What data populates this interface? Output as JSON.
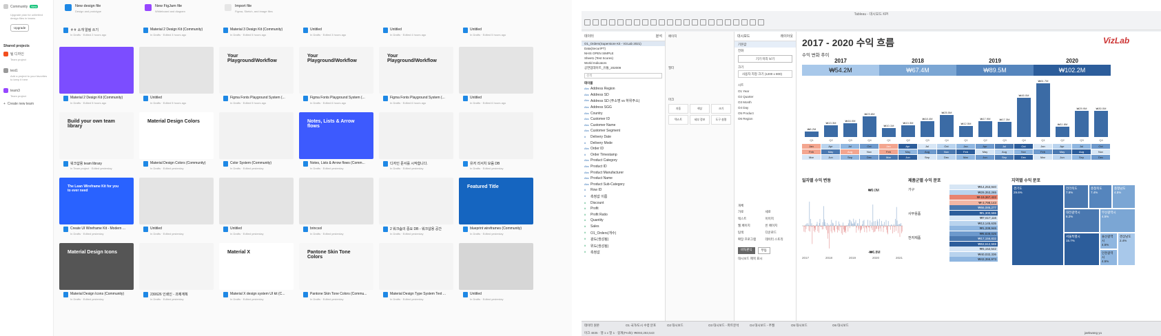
{
  "figma": {
    "sidebar": {
      "community": "Community",
      "new_badge": "New",
      "upgrade_text": "Upgrade plan for unlimited design files in teams",
      "upgrade_btn": "Upgrade",
      "shared": "Shared projects",
      "team1": "팀 디자인",
      "team1_sub": "Team project",
      "team2": "test1",
      "team2_sub": "Add a project to your favorites to keep it here",
      "team3": "team3",
      "team3_sub": "Team project",
      "create": "Create new team"
    },
    "newrow": [
      {
        "t1": "New design file",
        "t2": "Design and prototype",
        "color": "#1e88e5"
      },
      {
        "t1": "New FigJam file",
        "t2": "Whiteboard and diagram",
        "color": "#9747ff"
      },
      {
        "t1": "Import file",
        "t2": "Figma, Sketch, and image files",
        "color": "#e6e6e6"
      }
    ],
    "row0": [
      {
        "title": "ㅎㅎ 소개 알림 쓰기",
        "sub": "In Drafts · Edited 2 hours ago"
      },
      {
        "title": "Material 2 Design Kit (Community)",
        "sub": "In Drafts · Edited 3 hours ago"
      },
      {
        "title": "Material 3 Design Kit (Community)",
        "sub": "In Drafts · Edited 5 hours ago"
      },
      {
        "title": "Untitled",
        "sub": "In Drafts · Edited 3 hours ago"
      },
      {
        "title": "Untitled",
        "sub": "In Drafts · Edited 4 hours ago"
      },
      {
        "title": "Untitled",
        "sub": "In Drafts · Edited 5 hours ago"
      }
    ],
    "cards": [
      [
        {
          "title": "Material 2 Design Kit (Community)",
          "sub": "In Drafts · Edited 5 hours ago",
          "ttl": ""
        },
        {
          "title": "Untitled",
          "sub": "In Drafts · Edited 5 hours ago",
          "ttl": ""
        },
        {
          "title": "Figma Fonts Playground System (...",
          "sub": "In Drafts · Edited 5 hours ago",
          "ttl": "Your Playground/Workflow"
        },
        {
          "title": "Figma Fonts Playground System (...",
          "sub": "In Drafts · Edited 6 hours ago",
          "ttl": "Your Playground/Workflow"
        },
        {
          "title": "Figma Fonts Playground System (...",
          "sub": "In Drafts · Edited 6 hours ago",
          "ttl": "Your Playground/Workflow"
        },
        {
          "title": "Untitled",
          "sub": "In Drafts · Edited 6 hours ago",
          "ttl": ""
        }
      ],
      [
        {
          "title": "워크샵용 team library",
          "sub": "In Team project · Edited yesterday",
          "ttl": "Build your own team library"
        },
        {
          "title": "Material Design Colors (Community)",
          "sub": "In Drafts · Edited yesterday",
          "ttl": "Material Design Colors"
        },
        {
          "title": "Color System (Community)",
          "sub": "In Drafts · Edited yesterday",
          "ttl": ""
        },
        {
          "title": "Notes, Lists & Arrow flows (Comm...",
          "sub": "In Drafts · Edited yesterday",
          "ttl": "Notes, Lists & Arrow flows"
        },
        {
          "title": "디자인 문서를 시작합니다.",
          "sub": "In Drafts · Edited yesterday",
          "ttl": ""
        },
        {
          "title": "유저 리서치 모음 DB",
          "sub": "In Drafts · Edited yesterday",
          "ttl": ""
        }
      ],
      [
        {
          "title": "Create UI Wireframe Kit - Modern ...",
          "sub": "In Drafts · Edited yesterday",
          "ttl": "The Lean Wireframe Kit for you to ever need"
        },
        {
          "title": "Untitled",
          "sub": "In Drafts · Edited yesterday",
          "ttl": ""
        },
        {
          "title": "Untitled",
          "sub": "In Drafts · Edited yesterday",
          "ttl": ""
        },
        {
          "title": "brincsol",
          "sub": "In Drafts · Edited yesterday",
          "ttl": ""
        },
        {
          "title": "2 워크숍의 중요 DB - 워크샵용 공간",
          "sub": "In Drafts · Edited yesterday",
          "ttl": ""
        },
        {
          "title": "blueprint wireframes (Community)",
          "sub": "In Drafts · Edited yesterday",
          "ttl": "Featured Title"
        }
      ],
      [
        {
          "title": "Material Design Icons (Community)",
          "sub": "In Drafts · Edited yesterday",
          "ttl": "Material Design Icons"
        },
        {
          "title": "230626 인쇄인 - 과제계획",
          "sub": "In Drafts · Edited yesterday",
          "ttl": ""
        },
        {
          "title": "Material X design system UI kit (C...",
          "sub": "In Drafts · Edited yesterday",
          "ttl": "Material X"
        },
        {
          "title": "Pantone Skin Tone Colors (Commu...",
          "sub": "In Drafts · Edited yesterday",
          "ttl": "Pantone Skin Tone Colors"
        },
        {
          "title": "Material Design Type System Text ...",
          "sub": "In Drafts · Edited yesterday",
          "ttl": ""
        },
        {
          "title": "Untitled",
          "sub": "In Drafts · Edited yesterday",
          "ttl": ""
        }
      ]
    ]
  },
  "tableau": {
    "window_title": "Tableau - 대시보드 KPI",
    "data_tab": "데이터",
    "analytics_tab": "분석",
    "datasources": [
      "O1_Orders(Superstore Kit - VizLab 2021)",
      "Data(SecuriPT)",
      "NHIS OPEN SIMPLE",
      "Sheet1 (Test Scores)",
      "World Indicators",
      "공연업데이트_유통_202009"
    ],
    "search": "검색",
    "table_hdr": "테이블",
    "fields": [
      [
        "Abc",
        "Address Region"
      ],
      [
        "Abc",
        "Address SD"
      ],
      [
        "Abc",
        "Address SD (주소명 vs 하위주소)"
      ],
      [
        "Abc",
        "Address SGG"
      ],
      [
        "Abc",
        "Country"
      ],
      [
        "Abc",
        "Customer ID"
      ],
      [
        "Abc",
        "Customer Name"
      ],
      [
        "Abc",
        "Customer Segment"
      ],
      [
        "#",
        "Delivery Date"
      ],
      [
        "#",
        "Delivery Mode"
      ],
      [
        "Abc",
        "Order ID"
      ],
      [
        "#",
        "Order Timestamp"
      ],
      [
        "Abc",
        "Product Category"
      ],
      [
        "Abc",
        "Product ID"
      ],
      [
        "Abc",
        "Product Manufacturer"
      ],
      [
        "Abc",
        "Product Name"
      ],
      [
        "Abc",
        "Product Sub-Category"
      ],
      [
        "#",
        "Row ID"
      ],
      [
        "#",
        "측정값 이름"
      ],
      [
        "m",
        "Discount"
      ],
      [
        "m",
        "Profit"
      ],
      [
        "m",
        "Profit Ratio"
      ],
      [
        "m",
        "Quantity"
      ],
      [
        "m",
        "Sales"
      ],
      [
        "m",
        "O1_Orders(개수)"
      ],
      [
        "m",
        "광도(생성됨)"
      ],
      [
        "m",
        "위도(생성됨)"
      ],
      [
        "m",
        "측정값"
      ]
    ],
    "pages": "페이지",
    "filters": "필터",
    "marks": "마크",
    "mark_items": [
      "자동",
      "색상",
      "크기",
      "텍스트",
      "세부 정보",
      "도구 설명"
    ],
    "dash_tab": "대시보드",
    "layout_tab": "레이아웃",
    "device": "기본값",
    "device2": "전화",
    "preview": "기기 미리 보기",
    "size_label": "크기",
    "size_value": "사용자 지정 크기 (1200 x 800)",
    "sheets_label": "시트",
    "sheets": [
      "O1 Year",
      "O2 Quarter",
      "O3 Month",
      "O4 Day",
      "O5 Product",
      "O6 Region"
    ],
    "objects_label": "개체",
    "objects": [
      "가로",
      "세로",
      "텍스트",
      "이미지",
      "웹 페이지",
      "빈 페이지",
      "탐색",
      "다운로드",
      "확장 프로그램",
      "데이터 스토리"
    ],
    "tiled": "바둑판식",
    "floating": "부동",
    "show_title": "대시보드 제목 표시",
    "title": "2017 - 2020 수익 흐름",
    "logo": "VizLab",
    "card_title": "수익 변화 추이",
    "years": [
      "2017",
      "2018",
      "2019",
      "2020"
    ],
    "kpis": [
      "₩54.2M",
      "₩67.4M",
      "₩89.5M",
      "₩102.2M"
    ],
    "kpi_colors": [
      "#a8c8ea",
      "#7ba6d4",
      "#5585bd",
      "#2c5d9b"
    ],
    "quarters": [
      "Q1",
      "Q2",
      "Q3",
      "Q4",
      "Q1",
      "Q2",
      "Q3",
      "Q4",
      "Q1",
      "Q2",
      "Q3",
      "Q4",
      "Q1",
      "Q2",
      "Q3",
      "Q4"
    ],
    "bar_labels": [
      "₩6.2M",
      "₩13.3M",
      "₩16.0M",
      "₩23.8M",
      "₩10.1M",
      "₩13.3M",
      "₩18.4M",
      "₩25.5M",
      "₩12.5M",
      "₩17.9M",
      "₩17.3M",
      "₩45.0M",
      "₩61.7M",
      "₩11.8M",
      "₩29.9M",
      "₩30.0M"
    ],
    "months": [
      "Jan",
      "Apr",
      "Jul",
      "Oct",
      "Jan",
      "Apr",
      "Jul",
      "Oct",
      "Jan",
      "Apr",
      "Jul",
      "Oct",
      "Jan",
      "Apr",
      "Jul",
      "Oct",
      "Feb",
      "May",
      "Aug",
      "Nov",
      "Feb",
      "May",
      "Aug",
      "Nov",
      "Feb",
      "May",
      "Aug",
      "Nov",
      "Feb",
      "May",
      "Aug",
      "Nov",
      "Mar",
      "Jun",
      "Sep",
      "Dec",
      "Mar",
      "Jun",
      "Sep",
      "Dec",
      "Mar",
      "Jun",
      "Sep",
      "Dec",
      "Mar",
      "Jun",
      "Sep",
      "Dec"
    ],
    "daily_title": "일자별 수익 변동",
    "daily_max": "₩9.0M",
    "daily_min": "-₩6.8M",
    "daily_years": [
      "2017",
      "2018",
      "2019",
      "2020",
      "2021"
    ],
    "prod_title": "제품군별 수익 분포",
    "prod_cats": [
      "가구",
      "사무용품",
      "전자제품"
    ],
    "prod_vals": [
      "₩14,253,940",
      "₩29,353,265",
      "₩-19,367,422",
      "₩-3,798,143",
      "₩66,086,277",
      "₩1,300,586",
      "₩7,617,116",
      "₩13,145,635",
      "₩1,338,946",
      "₩8,838,025",
      "₩17,156,832",
      "₩63,612,559",
      "₩3,152,542",
      "₩40,032,336",
      "₩43,355,973"
    ],
    "region_title": "지역별 수익 분포",
    "regions": [
      {
        "n": "경기도",
        "v": "29.6%"
      },
      {
        "n": "전라북도",
        "v": "7.8%"
      },
      {
        "n": "충청북도",
        "v": "7.4%"
      },
      {
        "n": "충청남도",
        "v": "4.5%"
      },
      {
        "n": "대전광역시",
        "v": "6.2%"
      },
      {
        "n": "부산광역시",
        "v": "4.5%"
      },
      {
        "n": "서울특별시",
        "v": "15.7%"
      },
      {
        "n": "울산광역시",
        "v": "4.5%"
      },
      {
        "n": "경상남도",
        "v": "2.4%"
      },
      {
        "n": "인천광역시",
        "v": "4.5%"
      }
    ],
    "bottom_tabs": [
      "데이터 원본",
      "O1 국가/도시 수령 분포",
      "O2 대시보드",
      "O3 대시보드 - 파트분석",
      "O4 대시보드 - 추월",
      "O5 대시보드",
      "O6 대시보드"
    ],
    "status": "마크 4835 · 행 1 x 열 1 · 합계(Profit): ₩293,283,543",
    "user": "jaekwang yu",
    "show_me": "표현 방식"
  }
}
